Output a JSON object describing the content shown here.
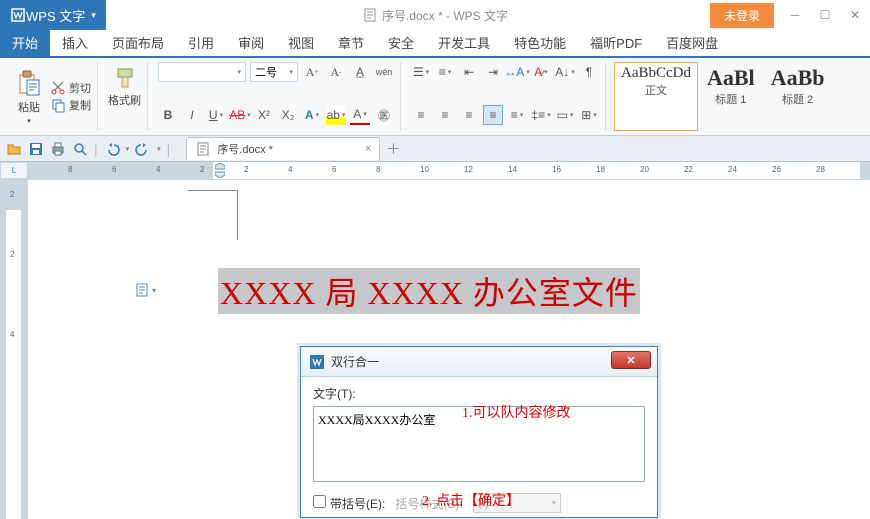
{
  "app": {
    "name": "WPS 文字",
    "title": "序号.docx * - WPS 文字",
    "login_btn": "未登录"
  },
  "tabs": [
    "开始",
    "插入",
    "页面布局",
    "引用",
    "审阅",
    "视图",
    "章节",
    "安全",
    "开发工具",
    "特色功能",
    "福昕PDF",
    "百度网盘"
  ],
  "active_tab_index": 0,
  "clipboard": {
    "paste": "粘贴",
    "cut": "剪切",
    "copy": "复制",
    "format_painter": "格式刷"
  },
  "font": {
    "name": "",
    "size": "二号"
  },
  "styles": [
    {
      "preview": "AaBbCcDd",
      "name": "正文",
      "big": false,
      "active": true
    },
    {
      "preview": "AaBl",
      "name": "标题 1",
      "big": true,
      "active": false
    },
    {
      "preview": "AaBb",
      "name": "标题 2",
      "big": true,
      "active": false
    }
  ],
  "doc_tab": {
    "name": "序号.docx *"
  },
  "ruler": {
    "marks": [
      "8",
      "6",
      "4",
      "2",
      "2",
      "4",
      "6",
      "8",
      "10",
      "12",
      "14",
      "16",
      "18",
      "20",
      "22",
      "24",
      "26",
      "28"
    ]
  },
  "vruler_marks": [
    "2",
    "2",
    "4"
  ],
  "page_selected": "XXXX 局 XXXX 办公室文件",
  "dialog": {
    "title": "双行合一",
    "text_label": "文字(T):",
    "text_value": "XXXX局XXXX办公室",
    "brackets_label": "带括号(E):",
    "brackets_checked": false,
    "style_label": "括号样式(B):",
    "style_value": "( )"
  },
  "annotations": {
    "a1": "1.可以队内容修改",
    "a2": "2. 点击【确定】"
  }
}
